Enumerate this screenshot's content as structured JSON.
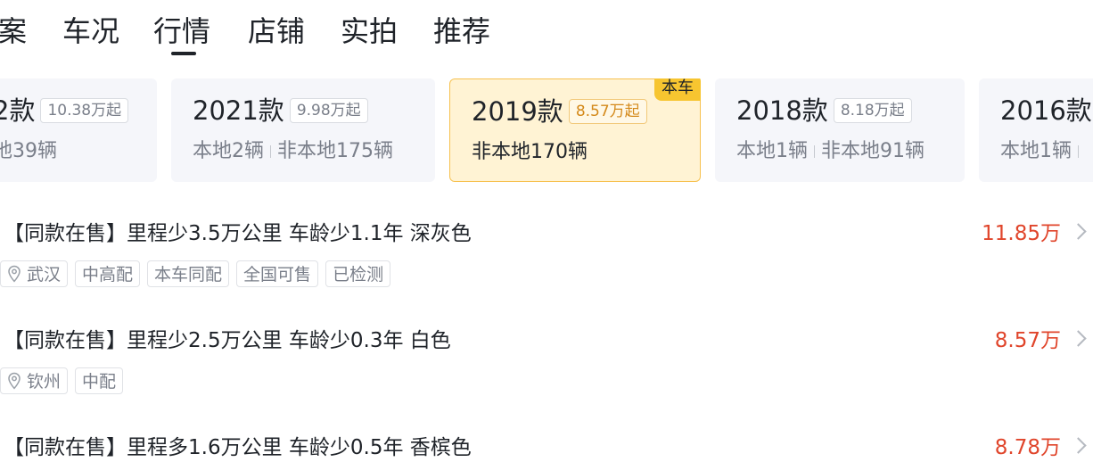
{
  "tabs": [
    {
      "label": "案"
    },
    {
      "label": "车况"
    },
    {
      "label": "行情",
      "active": true
    },
    {
      "label": "店铺"
    },
    {
      "label": "实拍"
    },
    {
      "label": "推荐"
    }
  ],
  "years": [
    {
      "year": "2款",
      "price": "10.38万起",
      "local": "",
      "nonlocal": "地39辆"
    },
    {
      "year": "2021款",
      "price": "9.98万起",
      "local": "本地2辆",
      "nonlocal": "非本地175辆"
    },
    {
      "year": "2019款",
      "price": "8.57万起",
      "local": "",
      "nonlocal": "非本地170辆",
      "badge": "本车",
      "active": true
    },
    {
      "year": "2018款",
      "price": "8.18万起",
      "local": "本地1辆",
      "nonlocal": "非本地91辆"
    },
    {
      "year": "2016款",
      "price": "",
      "local": "本地1辆",
      "nonlocal": ""
    }
  ],
  "listings": [
    {
      "title": "【同款在售】里程少3.5万公里 车龄少1.1年 深灰色",
      "price": "11.85万",
      "location": "武汉",
      "tags": [
        "中高配",
        "本车同配",
        "全国可售",
        "已检测"
      ]
    },
    {
      "title": "【同款在售】里程少2.5万公里 车龄少0.3年 白色",
      "price": "8.57万",
      "location": "钦州",
      "tags": [
        "中配"
      ]
    },
    {
      "title": "【同款在售】里程多1.6万公里 车龄少0.5年 香槟色",
      "price": "8.78万",
      "location": "",
      "tags": []
    }
  ],
  "colors": {
    "accent_price": "#e0452b",
    "active_card_bg": "#fff3d4",
    "badge_bg": "#f7c530"
  },
  "icons": {
    "location": "location-pin-icon",
    "chevron": "chevron-right-icon"
  }
}
